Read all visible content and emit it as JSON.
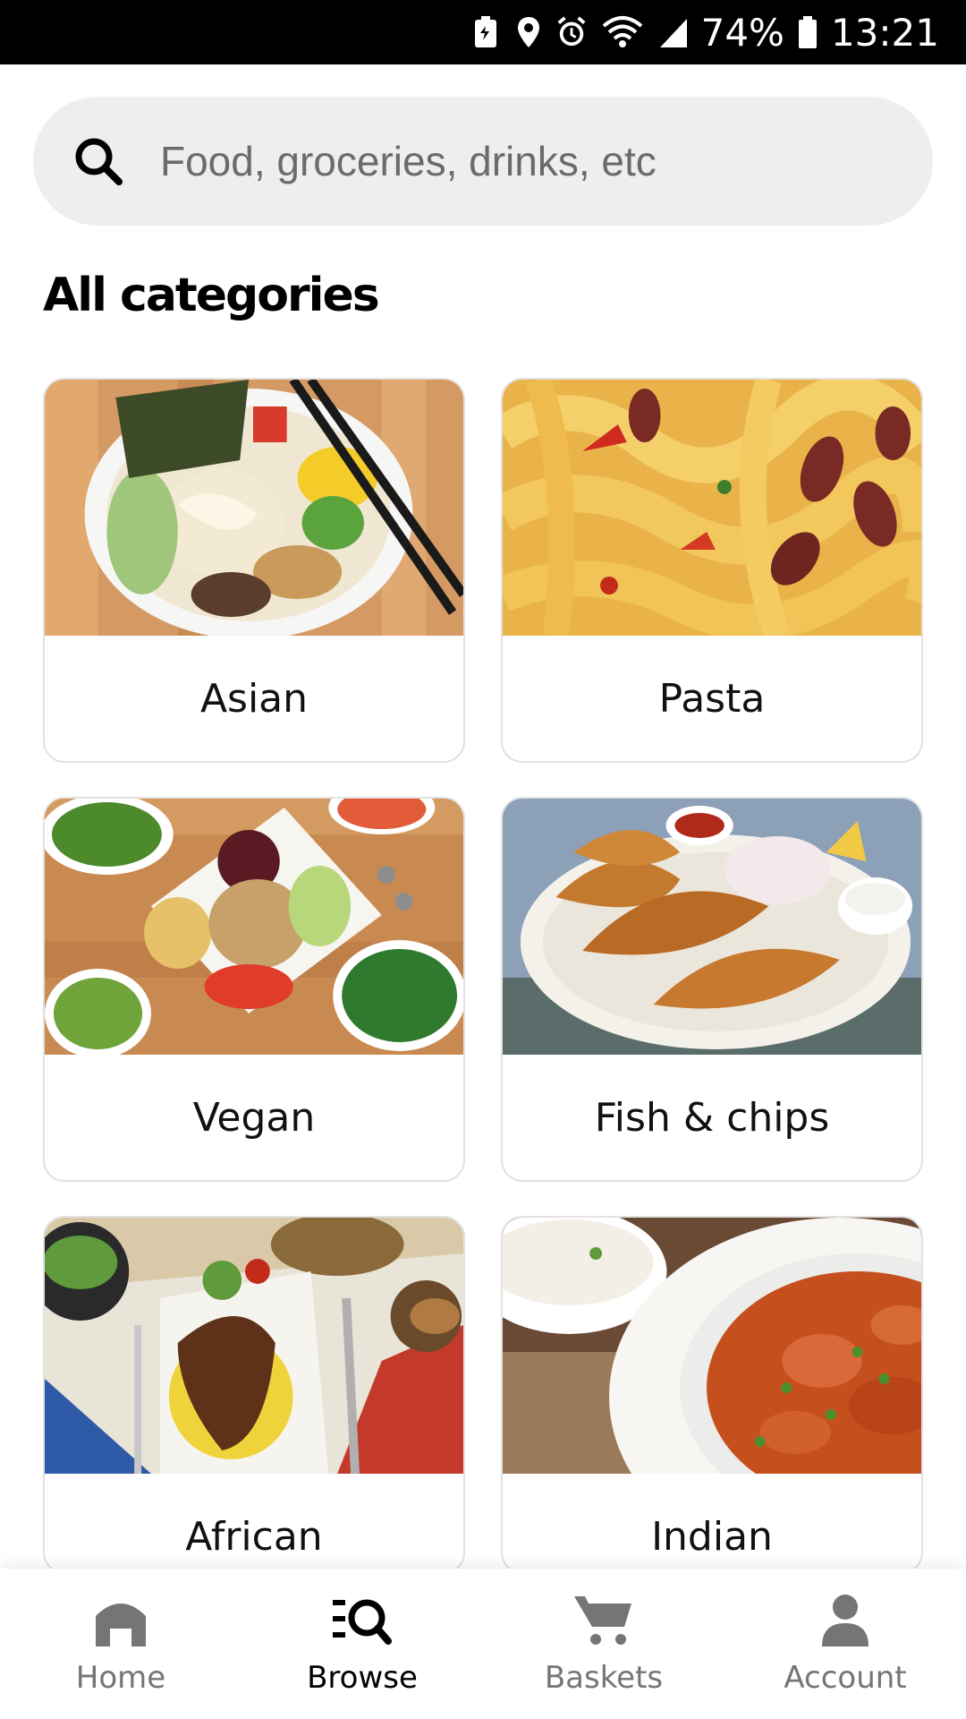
{
  "status_bar": {
    "battery_percent": "74%",
    "time": "13:21",
    "icons": [
      "battery-saver-icon",
      "location-icon",
      "alarm-icon",
      "wifi-icon",
      "signal-icon",
      "battery-icon"
    ]
  },
  "search": {
    "placeholder": "Food, groceries, drinks, etc",
    "value": "",
    "icon": "search-icon"
  },
  "main": {
    "title": "All categories",
    "categories": [
      {
        "label": "Asian",
        "image": "ramen-bowl-photo"
      },
      {
        "label": "Pasta",
        "image": "pasta-with-beans-photo"
      },
      {
        "label": "Vegan",
        "image": "salad-platter-photo"
      },
      {
        "label": "Fish & chips",
        "image": "fried-fish-photo"
      },
      {
        "label": "African",
        "image": "grilled-chicken-rice-photo"
      },
      {
        "label": "Indian",
        "image": "curry-and-rice-photo"
      }
    ]
  },
  "bottom_nav": {
    "items": [
      {
        "label": "Home",
        "icon": "home-icon",
        "active": false
      },
      {
        "label": "Browse",
        "icon": "browse-icon",
        "active": true
      },
      {
        "label": "Baskets",
        "icon": "cart-icon",
        "active": false
      },
      {
        "label": "Account",
        "icon": "person-icon",
        "active": false
      }
    ]
  },
  "colors": {
    "status_bar_bg": "#000000",
    "search_bg": "#eeeeee",
    "active_nav": "#000000",
    "inactive_nav": "#757575"
  }
}
